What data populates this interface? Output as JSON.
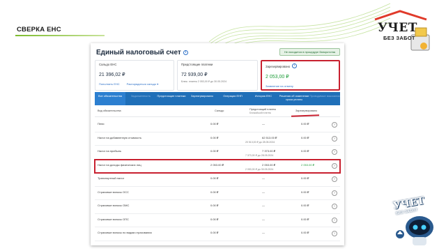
{
  "slide": {
    "title": "СВЕРКА ЕНС"
  },
  "logo": {
    "line1": "УЧЕТ",
    "line2": "БЕЗ ЗАБОТ"
  },
  "robot": {
    "line1": "УЧЕТ",
    "line2": "БЕЗ ЗАБОТ"
  },
  "screen": {
    "title": "Единый налоговый счет",
    "bankrupt_badge": "Не находится в процедуре банкротства",
    "cards": {
      "saldo": {
        "label": "Сальдо ЕНС",
        "value": "21 396,02 ₽",
        "link1": "Пополнить ЕНС",
        "link2": "Распорядиться сальдо"
      },
      "upcoming": {
        "label": "Предстоящие платежи",
        "value": "72 939,00 ₽",
        "sub": "Ближ. платеж 2 053,00 ₽ до 30.05.2024"
      },
      "reserved": {
        "label": "Зарезервировано",
        "value": "2 053,00 ₽",
        "link": "Заявление на отмену"
      }
    },
    "tabs": [
      "Все обязательства",
      "Задолженность",
      "Предстоящие платежи",
      "Зарезервировано",
      "Операции ЕНП",
      "История ЕНС",
      "Решения об изменении срока уплаты",
      "Проводимые взыскания"
    ],
    "columns": {
      "type": "Вид обязательства",
      "saldo": "Сальдо",
      "upcoming": "Предстоящий платеж",
      "upcoming_sub": "Ближайший платеж",
      "reserved": "Зарезервировано"
    },
    "rows": [
      {
        "name": "Пени",
        "saldo": "0.00 ₽",
        "upcoming": "—",
        "upcoming_sub": "",
        "reserved": "0.00 ₽"
      },
      {
        "name": "Налог на добавленную стоимость",
        "saldo": "0.00 ₽",
        "upcoming": "62 513.00 ₽",
        "upcoming_sub": "20 513,00 ₽ до 28.05.2024",
        "reserved": "0.00 ₽"
      },
      {
        "name": "Налог на прибыль",
        "saldo": "0.00 ₽",
        "upcoming": "7 373.00 ₽",
        "upcoming_sub": "7 373,00 ₽ до 28.05.2024",
        "reserved": "0.00 ₽"
      },
      {
        "name": "Налог на доходы физических лиц",
        "saldo": "2 053.00 ₽",
        "upcoming": "2 053.00 ₽",
        "upcoming_sub": "2 053,00 ₽ до 30.05.2024",
        "reserved": "2 053.00 ₽"
      },
      {
        "name": "Транспортный налог",
        "saldo": "0.00 ₽",
        "upcoming": "—",
        "upcoming_sub": "",
        "reserved": "0.00 ₽"
      },
      {
        "name": "Страховые взносы ОСС",
        "saldo": "0.00 ₽",
        "upcoming": "—",
        "upcoming_sub": "",
        "reserved": "0.00 ₽"
      },
      {
        "name": "Страховые взносы ОМС",
        "saldo": "0.00 ₽",
        "upcoming": "—",
        "upcoming_sub": "",
        "reserved": "0.00 ₽"
      },
      {
        "name": "Страховые взносы ОПС",
        "saldo": "0.00 ₽",
        "upcoming": "—",
        "upcoming_sub": "",
        "reserved": "0.00 ₽"
      },
      {
        "name": "Страховые взносы по видам страхования",
        "saldo": "0.00 ₽",
        "upcoming": "—",
        "upcoming_sub": "",
        "reserved": "0.00 ₽"
      }
    ]
  },
  "colors": {
    "accent": "#1f6fb8",
    "highlight": "#c8202f",
    "green": "#1f9d3a"
  }
}
